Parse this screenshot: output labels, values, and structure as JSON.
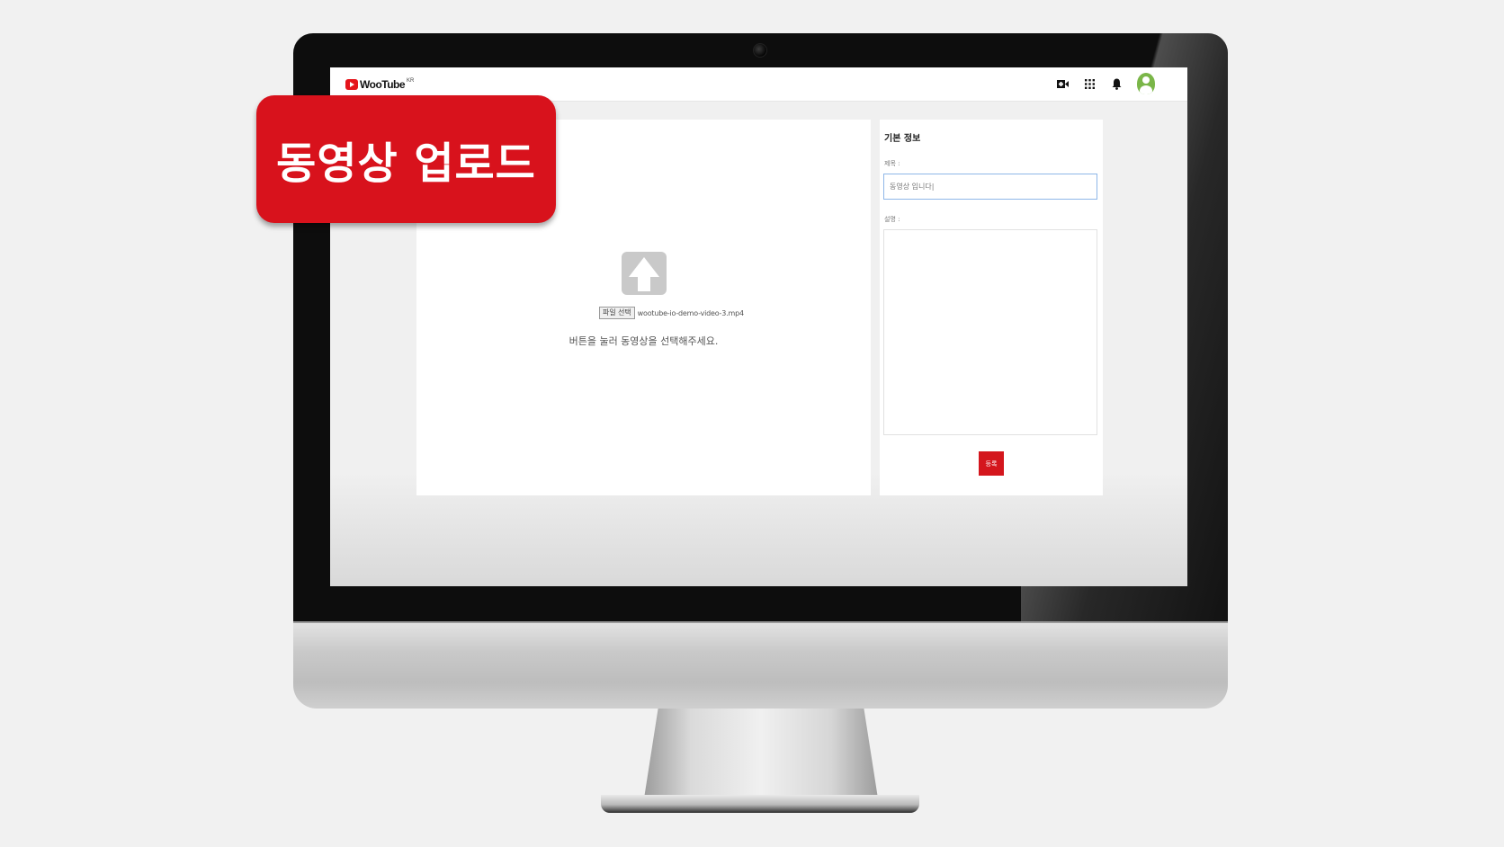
{
  "callout": {
    "label": "동영상 업로드"
  },
  "header": {
    "logo_text": "WooTube",
    "logo_region": "KR",
    "icons": [
      "video-add-icon",
      "apps-grid-icon",
      "bell-icon",
      "avatar"
    ]
  },
  "upload": {
    "file_button_label": "파일 선택",
    "file_name": "wootube-io-demo-video-3.mp4",
    "hint": "버튼을 눌러 동영상을 선택해주세요."
  },
  "info": {
    "section_title": "기본 정보",
    "title_label": "제목 :",
    "title_value": "동영상 입니다|",
    "description_label": "설명 :",
    "description_value": "",
    "submit_label": "등록"
  },
  "colors": {
    "accent": "#d8121c",
    "logo_red": "#e5141b",
    "avatar_green": "#7ab648",
    "input_focus": "#8fb7e8"
  }
}
